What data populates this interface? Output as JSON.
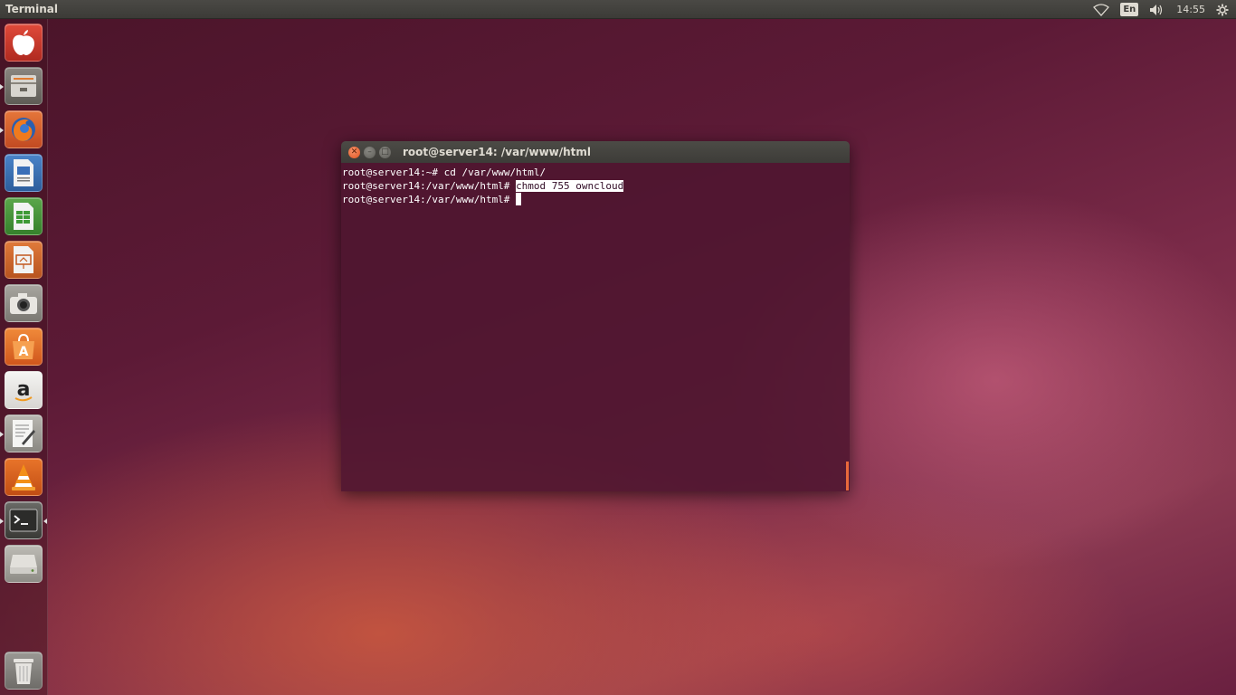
{
  "top_panel": {
    "app_title": "Terminal",
    "keyboard_layout": "En",
    "clock": "14:55",
    "icons": [
      "wifi-icon",
      "keyboard-layout-indicator",
      "volume-icon",
      "clock",
      "gear-icon"
    ]
  },
  "launcher": {
    "items": [
      {
        "name": "apple-icon",
        "running": false
      },
      {
        "name": "files-icon",
        "running": true
      },
      {
        "name": "firefox-icon",
        "running": true
      },
      {
        "name": "libreoffice-writer-icon",
        "running": false
      },
      {
        "name": "libreoffice-calc-icon",
        "running": false
      },
      {
        "name": "libreoffice-impress-icon",
        "running": false
      },
      {
        "name": "screenshot-camera-icon",
        "running": false
      },
      {
        "name": "software-center-icon",
        "running": false
      },
      {
        "name": "amazon-icon",
        "running": false
      },
      {
        "name": "text-editor-icon",
        "running": true
      },
      {
        "name": "vlc-icon",
        "running": false
      },
      {
        "name": "terminal-icon",
        "running": true,
        "focused": true
      },
      {
        "name": "disk-drive-icon",
        "running": false
      },
      {
        "name": "trash-icon",
        "running": false
      }
    ]
  },
  "terminal": {
    "title": "root@server14: /var/www/html",
    "lines": [
      {
        "prompt": "root@server14:~#",
        "command": " cd /var/www/html/"
      },
      {
        "prompt": "root@server14:/var/www/html#",
        "command": "chmod 755 owncloud",
        "selected": true
      },
      {
        "prompt": "root@server14:/var/www/html#",
        "command": ""
      }
    ]
  },
  "colors": {
    "panel": "#3c3b37",
    "terminal_bg": "#4e1630",
    "close_button": "#e9693b",
    "accent": "#e95420"
  }
}
